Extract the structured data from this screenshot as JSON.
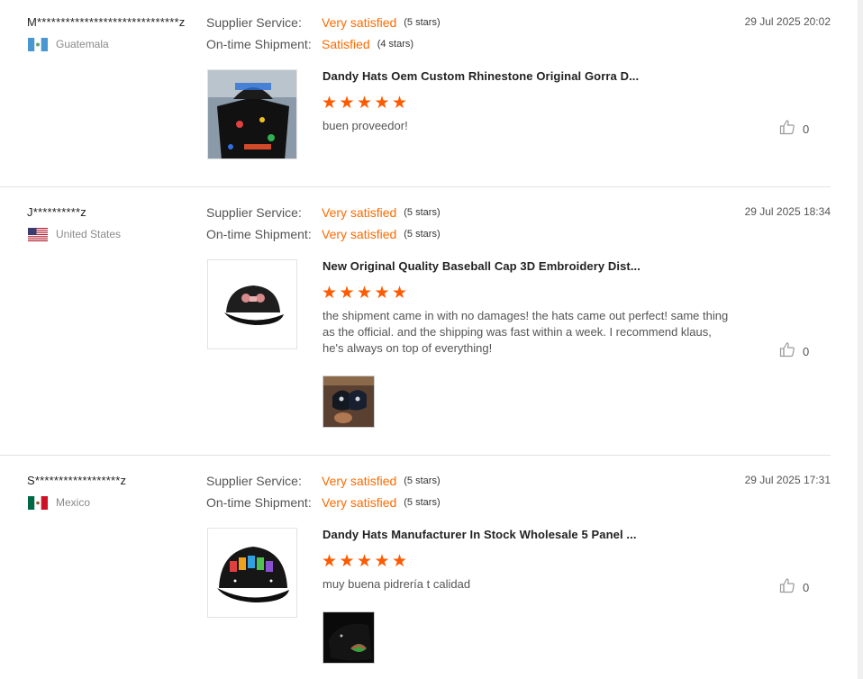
{
  "reviews": [
    {
      "reviewer": "M******************************z",
      "country": "Guatemala",
      "date": "29 Jul 2025 20:02",
      "supplier_label": "Supplier Service:",
      "supplier_value": "Very satisfied",
      "supplier_stars": "(5 stars)",
      "shipment_label": "On-time Shipment:",
      "shipment_value": "Satisfied",
      "shipment_stars": "(4 stars)",
      "product_title": "Dandy Hats Oem Custom Rhinestone Original Gorra D...",
      "rating": 5,
      "comment": "buen proveedor!",
      "likes": "0"
    },
    {
      "reviewer": "J**********z",
      "country": "United States",
      "date": "29 Jul 2025 18:34",
      "supplier_label": "Supplier Service:",
      "supplier_value": "Very satisfied",
      "supplier_stars": "(5 stars)",
      "shipment_label": "On-time Shipment:",
      "shipment_value": "Very satisfied",
      "shipment_stars": "(5 stars)",
      "product_title": "New Original Quality Baseball Cap 3D Embroidery Dist...",
      "rating": 5,
      "comment": "the shipment came in with no damages! the hats came out perfect! same thing as the official. and the shipping was fast within a week. I recommend klaus, he's always on top of everything!",
      "likes": "0"
    },
    {
      "reviewer": "S******************z",
      "country": "Mexico",
      "date": "29 Jul 2025 17:31",
      "supplier_label": "Supplier Service:",
      "supplier_value": "Very satisfied",
      "supplier_stars": "(5 stars)",
      "shipment_label": "On-time Shipment:",
      "shipment_value": "Very satisfied",
      "shipment_stars": "(5 stars)",
      "product_title": "Dandy Hats Manufacturer In Stock Wholesale 5 Panel ...",
      "rating": 5,
      "comment": "muy buena pidrería t calidad",
      "likes": "0"
    }
  ],
  "icons": {
    "star": "star-icon",
    "like": "thumbs-up-icon"
  },
  "colors": {
    "accent": "#ff6a00",
    "star": "#ff5a00"
  }
}
